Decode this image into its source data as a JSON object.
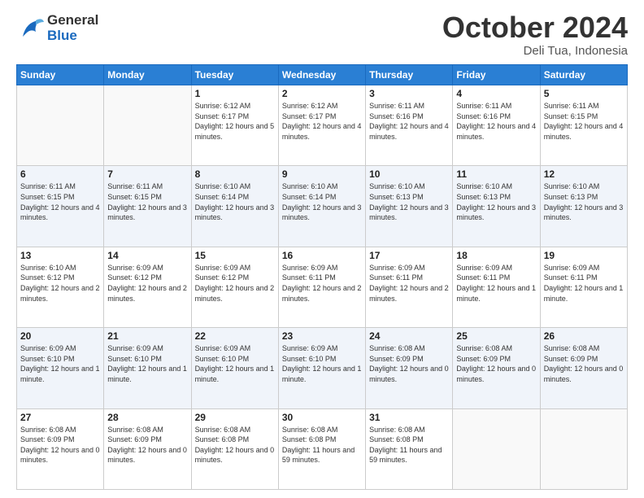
{
  "header": {
    "logo_general": "General",
    "logo_blue": "Blue",
    "month": "October 2024",
    "location": "Deli Tua, Indonesia"
  },
  "weekdays": [
    "Sunday",
    "Monday",
    "Tuesday",
    "Wednesday",
    "Thursday",
    "Friday",
    "Saturday"
  ],
  "weeks": [
    [
      {
        "day": null
      },
      {
        "day": null
      },
      {
        "day": "1",
        "sunrise": "6:12 AM",
        "sunset": "6:17 PM",
        "daylight": "12 hours and 5 minutes."
      },
      {
        "day": "2",
        "sunrise": "6:12 AM",
        "sunset": "6:17 PM",
        "daylight": "12 hours and 4 minutes."
      },
      {
        "day": "3",
        "sunrise": "6:11 AM",
        "sunset": "6:16 PM",
        "daylight": "12 hours and 4 minutes."
      },
      {
        "day": "4",
        "sunrise": "6:11 AM",
        "sunset": "6:16 PM",
        "daylight": "12 hours and 4 minutes."
      },
      {
        "day": "5",
        "sunrise": "6:11 AM",
        "sunset": "6:15 PM",
        "daylight": "12 hours and 4 minutes."
      }
    ],
    [
      {
        "day": "6",
        "sunrise": "6:11 AM",
        "sunset": "6:15 PM",
        "daylight": "12 hours and 4 minutes."
      },
      {
        "day": "7",
        "sunrise": "6:11 AM",
        "sunset": "6:15 PM",
        "daylight": "12 hours and 3 minutes."
      },
      {
        "day": "8",
        "sunrise": "6:10 AM",
        "sunset": "6:14 PM",
        "daylight": "12 hours and 3 minutes."
      },
      {
        "day": "9",
        "sunrise": "6:10 AM",
        "sunset": "6:14 PM",
        "daylight": "12 hours and 3 minutes."
      },
      {
        "day": "10",
        "sunrise": "6:10 AM",
        "sunset": "6:13 PM",
        "daylight": "12 hours and 3 minutes."
      },
      {
        "day": "11",
        "sunrise": "6:10 AM",
        "sunset": "6:13 PM",
        "daylight": "12 hours and 3 minutes."
      },
      {
        "day": "12",
        "sunrise": "6:10 AM",
        "sunset": "6:13 PM",
        "daylight": "12 hours and 3 minutes."
      }
    ],
    [
      {
        "day": "13",
        "sunrise": "6:10 AM",
        "sunset": "6:12 PM",
        "daylight": "12 hours and 2 minutes."
      },
      {
        "day": "14",
        "sunrise": "6:09 AM",
        "sunset": "6:12 PM",
        "daylight": "12 hours and 2 minutes."
      },
      {
        "day": "15",
        "sunrise": "6:09 AM",
        "sunset": "6:12 PM",
        "daylight": "12 hours and 2 minutes."
      },
      {
        "day": "16",
        "sunrise": "6:09 AM",
        "sunset": "6:11 PM",
        "daylight": "12 hours and 2 minutes."
      },
      {
        "day": "17",
        "sunrise": "6:09 AM",
        "sunset": "6:11 PM",
        "daylight": "12 hours and 2 minutes."
      },
      {
        "day": "18",
        "sunrise": "6:09 AM",
        "sunset": "6:11 PM",
        "daylight": "12 hours and 1 minute."
      },
      {
        "day": "19",
        "sunrise": "6:09 AM",
        "sunset": "6:11 PM",
        "daylight": "12 hours and 1 minute."
      }
    ],
    [
      {
        "day": "20",
        "sunrise": "6:09 AM",
        "sunset": "6:10 PM",
        "daylight": "12 hours and 1 minute."
      },
      {
        "day": "21",
        "sunrise": "6:09 AM",
        "sunset": "6:10 PM",
        "daylight": "12 hours and 1 minute."
      },
      {
        "day": "22",
        "sunrise": "6:09 AM",
        "sunset": "6:10 PM",
        "daylight": "12 hours and 1 minute."
      },
      {
        "day": "23",
        "sunrise": "6:09 AM",
        "sunset": "6:10 PM",
        "daylight": "12 hours and 1 minute."
      },
      {
        "day": "24",
        "sunrise": "6:08 AM",
        "sunset": "6:09 PM",
        "daylight": "12 hours and 0 minutes."
      },
      {
        "day": "25",
        "sunrise": "6:08 AM",
        "sunset": "6:09 PM",
        "daylight": "12 hours and 0 minutes."
      },
      {
        "day": "26",
        "sunrise": "6:08 AM",
        "sunset": "6:09 PM",
        "daylight": "12 hours and 0 minutes."
      }
    ],
    [
      {
        "day": "27",
        "sunrise": "6:08 AM",
        "sunset": "6:09 PM",
        "daylight": "12 hours and 0 minutes."
      },
      {
        "day": "28",
        "sunrise": "6:08 AM",
        "sunset": "6:09 PM",
        "daylight": "12 hours and 0 minutes."
      },
      {
        "day": "29",
        "sunrise": "6:08 AM",
        "sunset": "6:08 PM",
        "daylight": "12 hours and 0 minutes."
      },
      {
        "day": "30",
        "sunrise": "6:08 AM",
        "sunset": "6:08 PM",
        "daylight": "11 hours and 59 minutes."
      },
      {
        "day": "31",
        "sunrise": "6:08 AM",
        "sunset": "6:08 PM",
        "daylight": "11 hours and 59 minutes."
      },
      {
        "day": null
      },
      {
        "day": null
      }
    ]
  ],
  "labels": {
    "sunrise": "Sunrise:",
    "sunset": "Sunset:",
    "daylight": "Daylight:"
  }
}
